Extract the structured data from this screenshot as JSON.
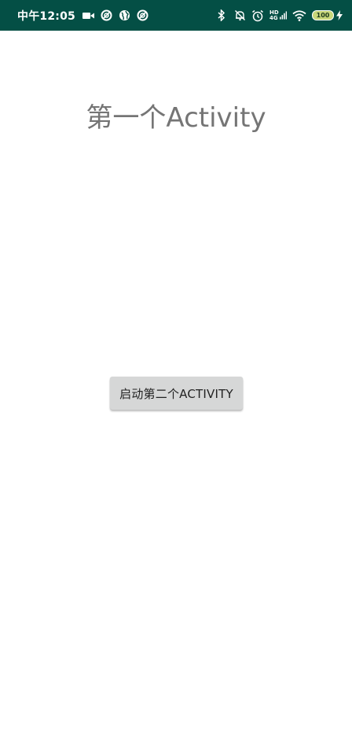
{
  "status_bar": {
    "time": "中午12:05",
    "battery_level": "100",
    "network_label_top": "HD",
    "network_label_bottom": "4G",
    "background_color": "#044f45",
    "icons_left": [
      "video-camera-icon",
      "notification-icon",
      "globe-icon",
      "notification-icon"
    ],
    "icons_right": [
      "bluetooth-icon",
      "mute-bell-icon",
      "alarm-icon",
      "signal-icon",
      "wifi-icon",
      "battery-icon",
      "charging-icon"
    ]
  },
  "main": {
    "title": "第一个Activity",
    "button_label": "启动第二个ACTIVITY"
  },
  "colors": {
    "title_text": "#757575",
    "button_background": "#d6d7d7",
    "page_background": "#ffffff"
  }
}
